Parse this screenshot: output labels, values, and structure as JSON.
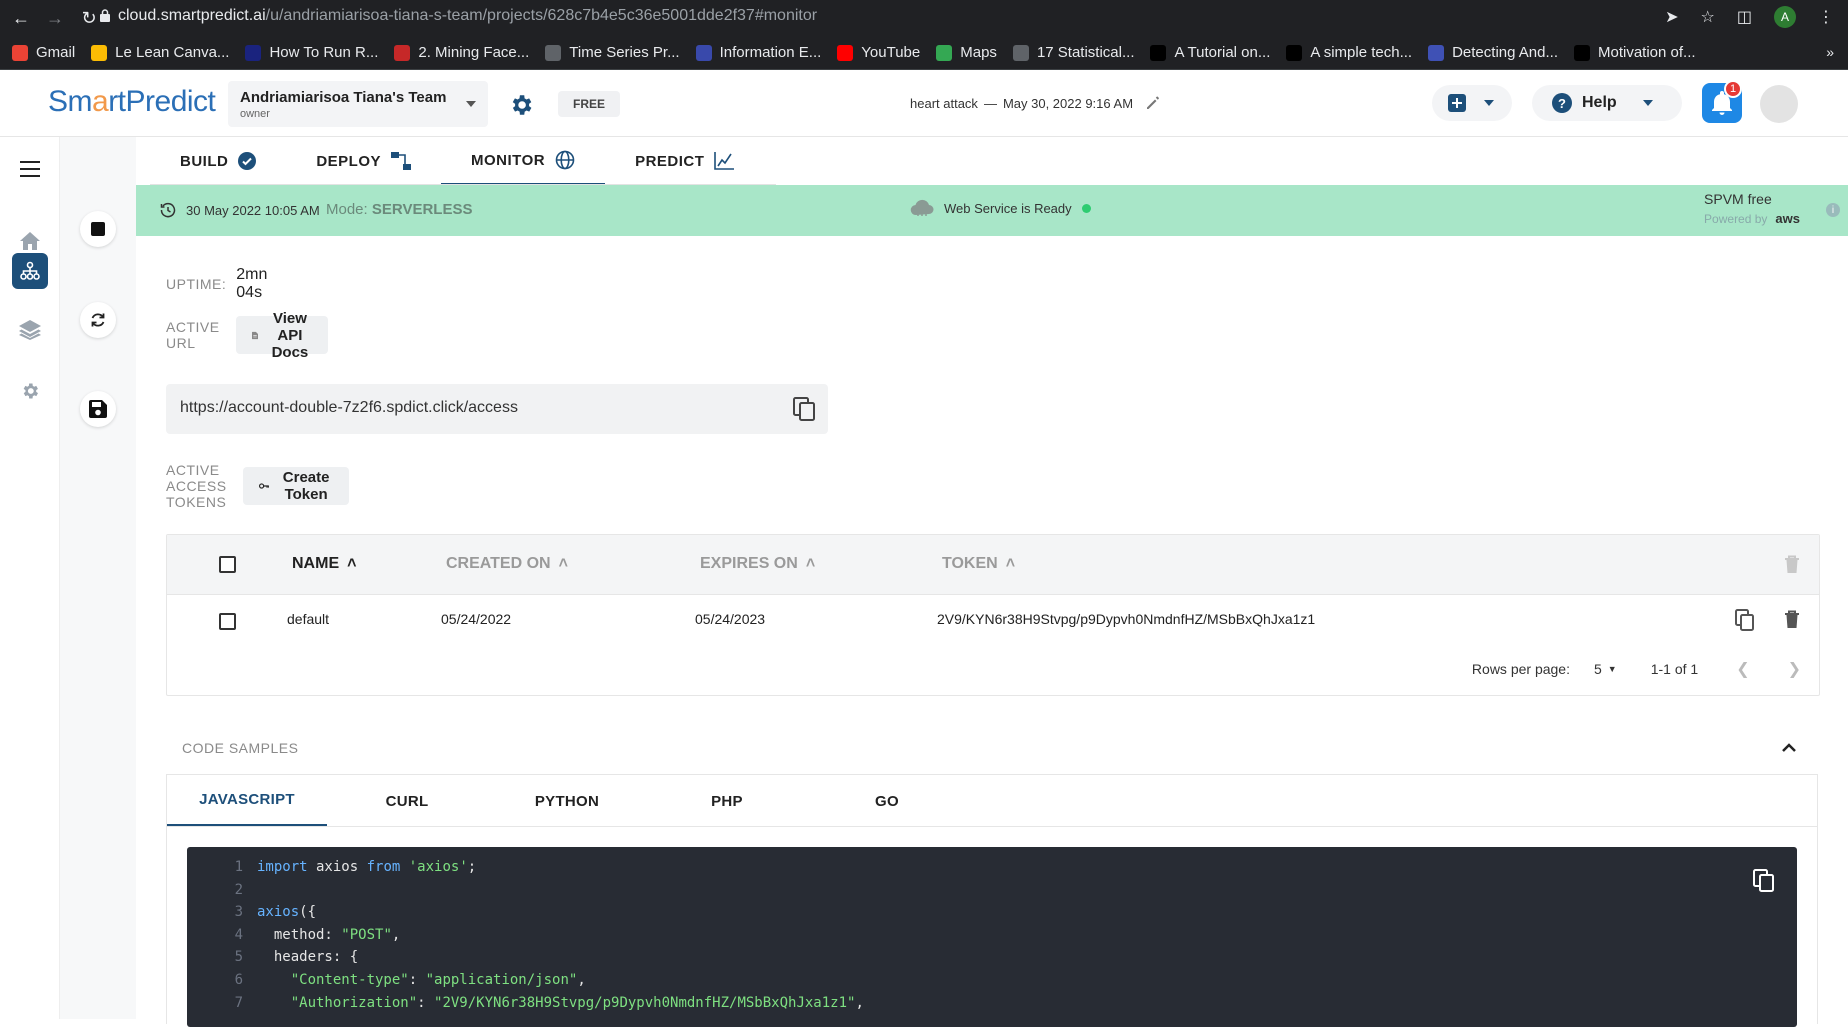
{
  "browser": {
    "url_host": "cloud.smartpredict.ai",
    "url_path": "/u/andriamiarisoa-tiana-s-team/projects/628c7b4e5c36e5001dde2f37#monitor",
    "profile_initial": "A",
    "bookmarks": [
      {
        "label": "Gmail",
        "color": "#ea4335"
      },
      {
        "label": "Le Lean Canva...",
        "color": "#fbbc04"
      },
      {
        "label": "How To Run R...",
        "color": "#1a237e"
      },
      {
        "label": "2. Mining Face...",
        "color": "#c62828"
      },
      {
        "label": "Time Series Pr...",
        "color": "#5f6368"
      },
      {
        "label": "Information E...",
        "color": "#3949ab"
      },
      {
        "label": "YouTube",
        "color": "#ff0000"
      },
      {
        "label": "Maps",
        "color": "#34a853"
      },
      {
        "label": "17 Statistical...",
        "color": "#5f6368"
      },
      {
        "label": "A Tutorial on...",
        "color": "#000000"
      },
      {
        "label": "A simple tech...",
        "color": "#000000"
      },
      {
        "label": "Detecting And...",
        "color": "#3f51b5"
      },
      {
        "label": "Motivation of...",
        "color": "#000000"
      }
    ],
    "more": "»"
  },
  "header": {
    "logo_pre": "Sm",
    "logo_o": "a",
    "logo_post": "rtPredict",
    "team_name": "Andriamiarisoa Tiana's Team",
    "team_role": "owner",
    "plan_badge": "FREE",
    "project_name": "heart attack",
    "project_sep": "—",
    "project_date": "May 30, 2022 9:16 AM",
    "help_label": "Help",
    "notification_count": "1"
  },
  "tabs": [
    {
      "label": "BUILD"
    },
    {
      "label": "DEPLOY"
    },
    {
      "label": "MONITOR"
    },
    {
      "label": "PREDICT"
    }
  ],
  "status": {
    "timestamp": "30 May 2022 10:05 AM",
    "mode_label": "Mode:",
    "mode_value": "SERVERLESS",
    "ready_text": "Web Service is Ready",
    "plan_name": "SPVM free",
    "powered_by": "Powered by",
    "provider": "aws"
  },
  "monitor": {
    "uptime_label": "UPTIME:",
    "uptime_value": "2mn 04s",
    "active_url_label": "ACTIVE URL",
    "view_api_docs": "View API Docs",
    "endpoint_url": "https://account-double-7z2f6.spdict.click/access",
    "tokens_label": "ACTIVE ACCESS TOKENS",
    "create_token": "Create Token"
  },
  "tokens_table": {
    "columns": [
      "NAME",
      "CREATED ON",
      "EXPIRES ON",
      "TOKEN"
    ],
    "rows": [
      {
        "name": "default",
        "created_on": "05/24/2022",
        "expires_on": "05/24/2023",
        "token": "2V9/KYN6r38H9Stvpg/p9Dypvh0NmdnfHZ/MSbBxQhJxa1z1"
      }
    ],
    "rows_per_page_label": "Rows per page:",
    "rows_per_page_value": "5",
    "range": "1-1 of 1"
  },
  "code_samples": {
    "header": "CODE SAMPLES",
    "languages": [
      "JAVASCRIPT",
      "CURL",
      "PYTHON",
      "PHP",
      "GO"
    ],
    "active_language": "JAVASCRIPT",
    "lines": [
      {
        "n": "1",
        "parts": [
          [
            "kw",
            "import"
          ],
          [
            "pl",
            " axios "
          ],
          [
            "kw",
            "from"
          ],
          [
            "pl",
            " "
          ],
          [
            "str",
            "'axios'"
          ],
          [
            "pl",
            ";"
          ]
        ]
      },
      {
        "n": "2",
        "parts": []
      },
      {
        "n": "3",
        "parts": [
          [
            "kw",
            "axios"
          ],
          [
            "pl",
            "({"
          ]
        ]
      },
      {
        "n": "4",
        "parts": [
          [
            "pl",
            "  method: "
          ],
          [
            "str",
            "\"POST\""
          ],
          [
            "pl",
            ","
          ]
        ]
      },
      {
        "n": "5",
        "parts": [
          [
            "pl",
            "  headers: {"
          ]
        ]
      },
      {
        "n": "6",
        "parts": [
          [
            "pl",
            "    "
          ],
          [
            "str",
            "\"Content-type\""
          ],
          [
            "pl",
            ": "
          ],
          [
            "str",
            "\"application/json\""
          ],
          [
            "pl",
            ","
          ]
        ]
      },
      {
        "n": "7",
        "parts": [
          [
            "pl",
            "    "
          ],
          [
            "str",
            "\"Authorization\""
          ],
          [
            "pl",
            ": "
          ],
          [
            "str",
            "\"2V9/KYN6r38H9Stvpg/p9Dypvh0NmdnfHZ/MSbBxQhJxa1z1\""
          ],
          [
            "pl",
            ","
          ]
        ]
      }
    ]
  }
}
